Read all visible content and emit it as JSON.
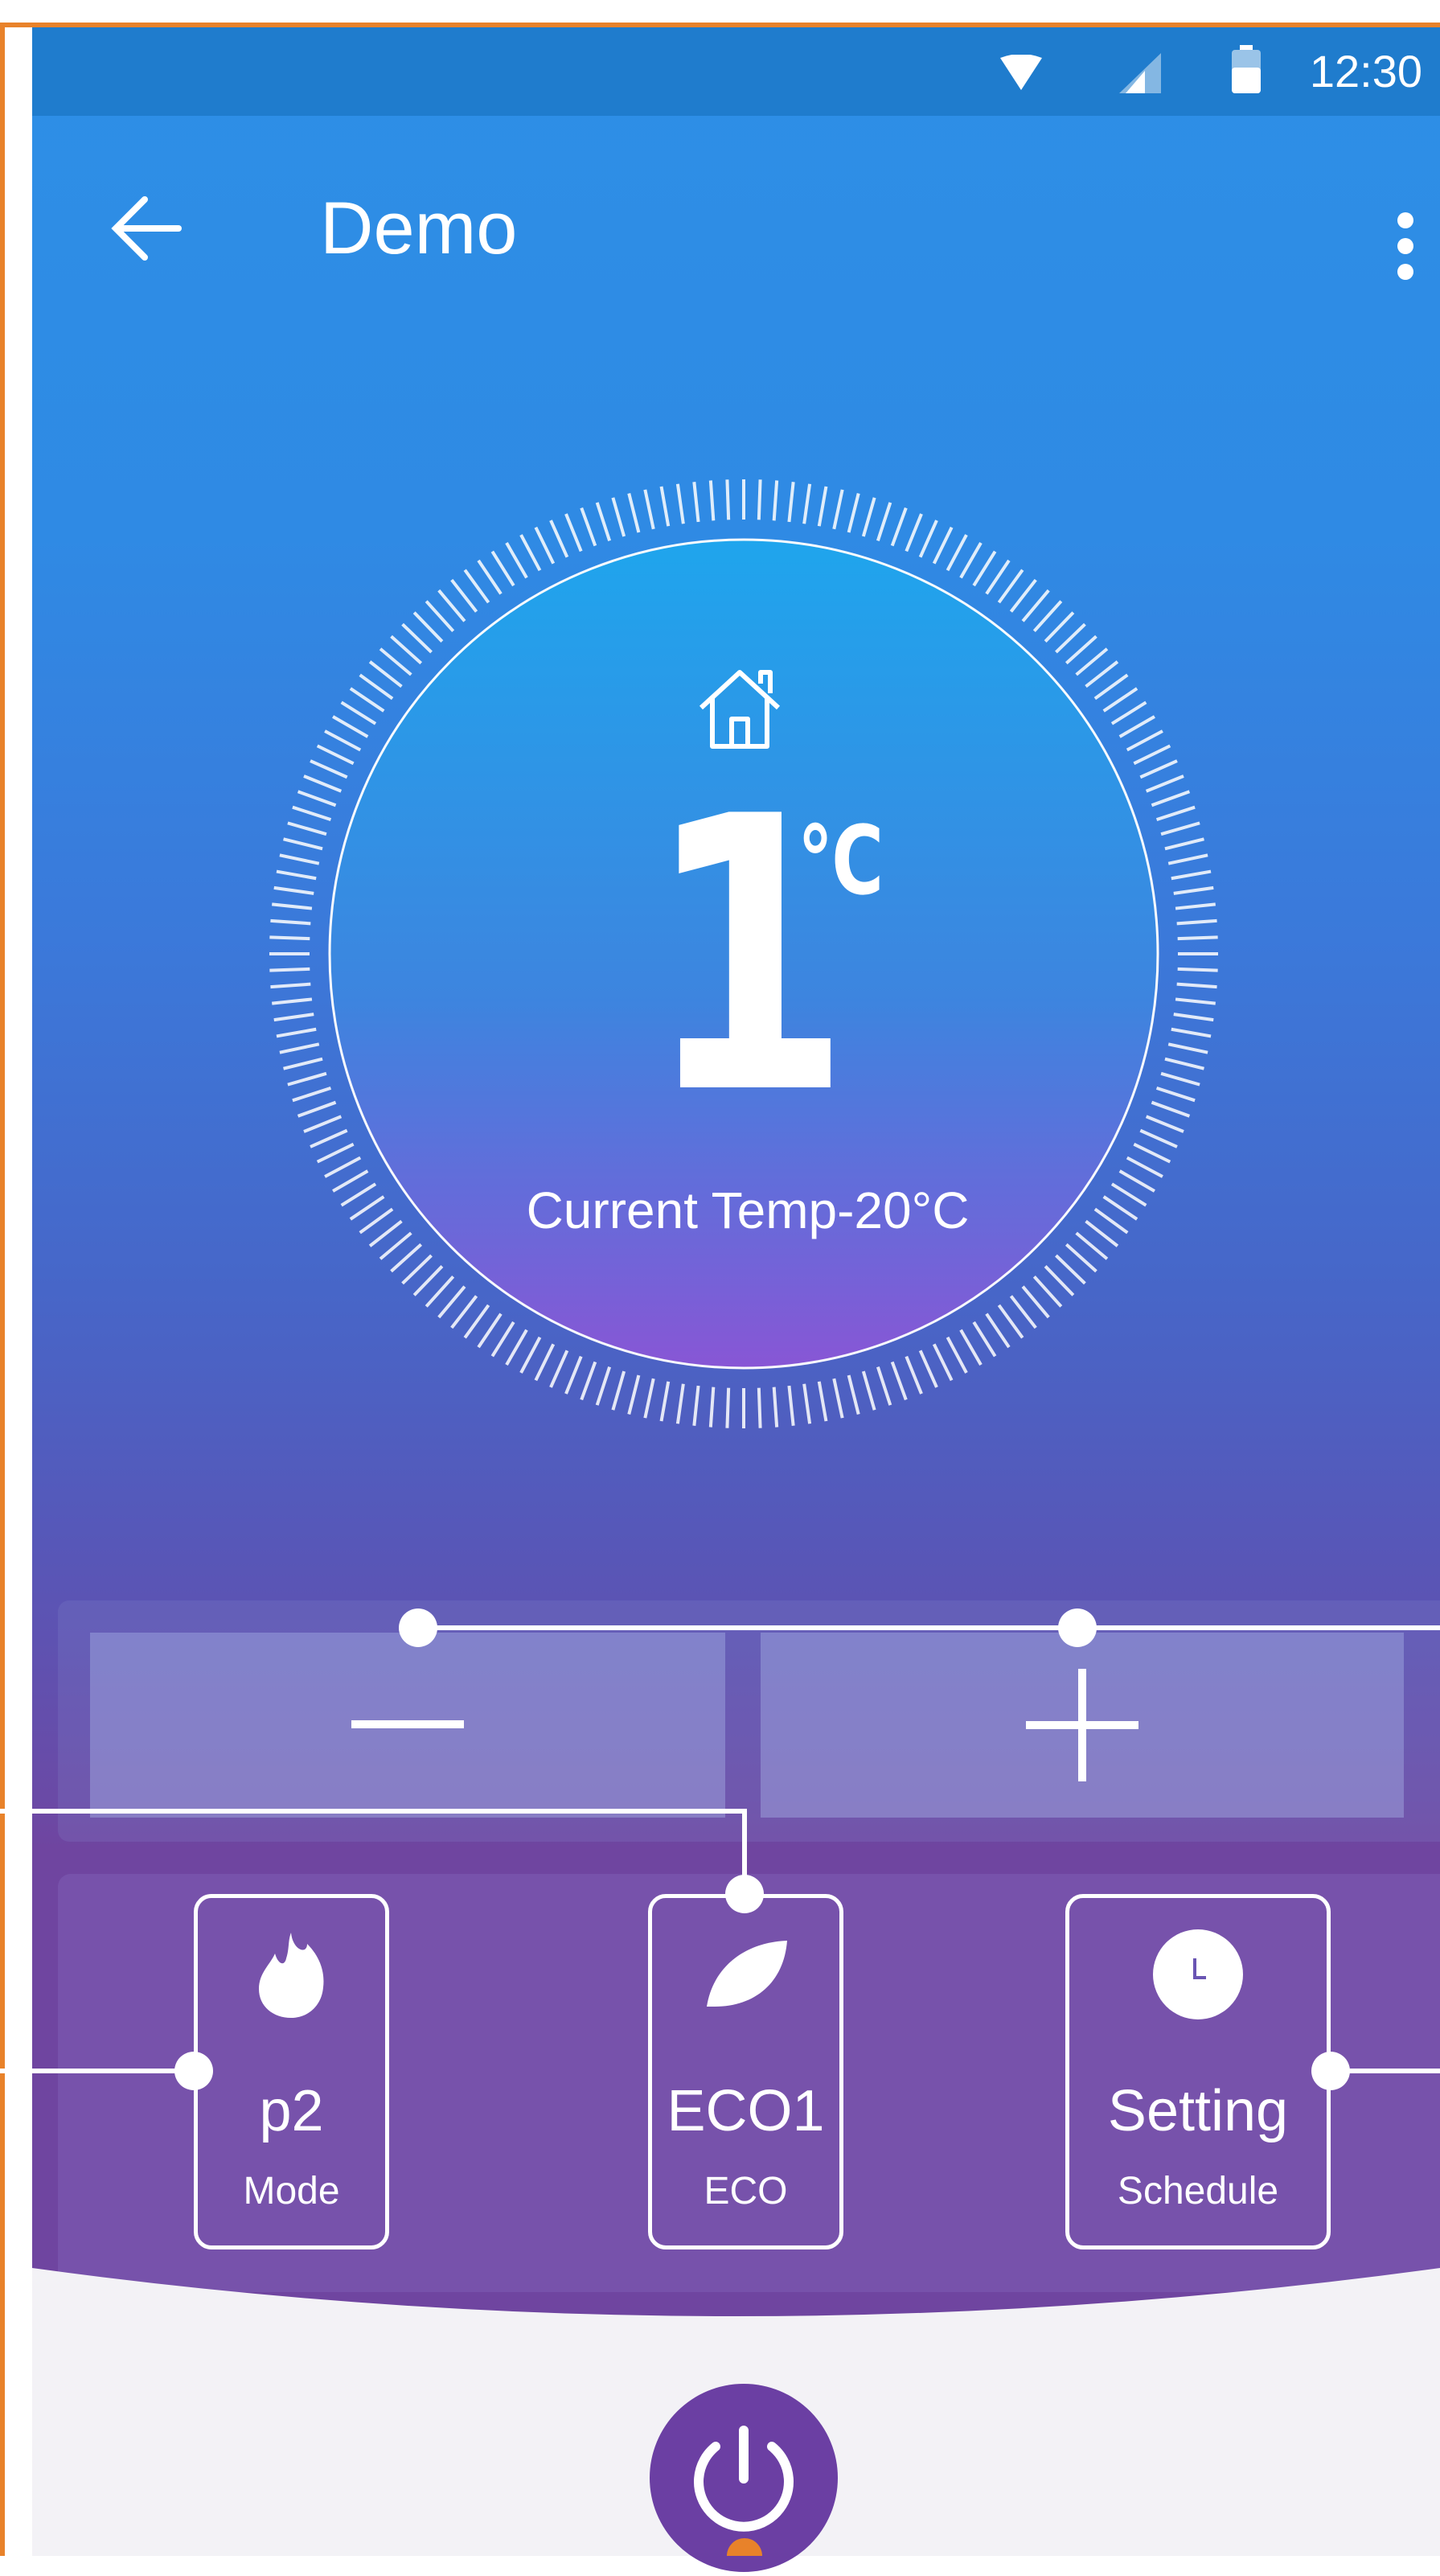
{
  "status_bar": {
    "time": "12:30",
    "icons": [
      "wifi-icon",
      "signal-icon",
      "battery-icon"
    ]
  },
  "header": {
    "title": "Demo",
    "back_icon": "arrow-left-icon",
    "menu_icon": "more-vertical-icon"
  },
  "thermostat": {
    "set_temperature": "1",
    "unit": "℃",
    "current_temp_label": "Current Temp-20°C",
    "home_icon": "home-icon"
  },
  "controls": {
    "decrease_icon": "minus-icon",
    "increase_icon": "plus-icon"
  },
  "tiles": [
    {
      "value": "p2",
      "label": "Mode",
      "icon": "flame-icon"
    },
    {
      "value": "ECO1",
      "label": "ECO",
      "icon": "leaf-icon"
    },
    {
      "value": "Setting",
      "label": "Schedule",
      "icon": "clock-icon"
    }
  ],
  "power": {
    "icon": "power-icon"
  },
  "colors": {
    "accent": "#6b3fa3",
    "frame": "#e8822a",
    "gradient_top": "#2d8fe6",
    "gradient_bottom": "#6f45a0"
  }
}
